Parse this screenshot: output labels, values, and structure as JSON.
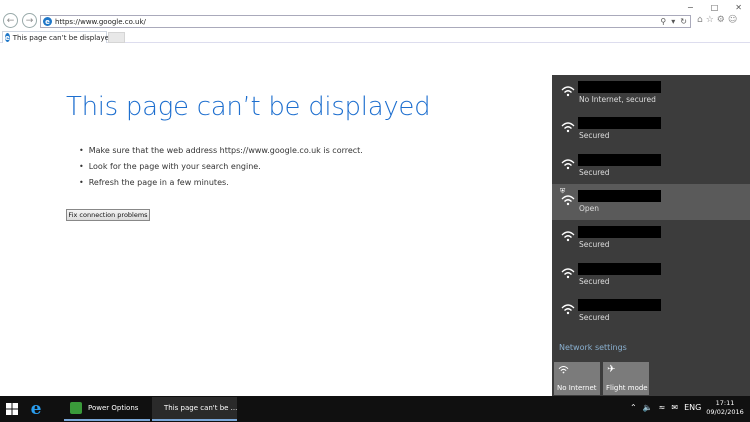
{
  "browser": {
    "url": "https://www.google.co.uk/",
    "tab_title": "This page can’t be displayed",
    "window_controls": [
      "−",
      "□",
      "✕"
    ],
    "addr_tools": [
      "search-icon",
      "dropdown-icon",
      "refresh-icon"
    ],
    "right_tools": [
      "home-icon",
      "star-icon",
      "gear-icon",
      "smiley-icon"
    ]
  },
  "page": {
    "title": "This page can’t be displayed",
    "bullets": [
      "Make sure that the web address https://www.google.co.uk is correct.",
      "Look for the page with your search engine.",
      "Refresh the page in a few minutes."
    ],
    "fix_button": "Fix connection problems"
  },
  "network_flyout": {
    "networks": [
      {
        "status": "No Internet, secured",
        "selected": false,
        "shield": false
      },
      {
        "status": "Secured",
        "selected": false,
        "shield": false
      },
      {
        "status": "Secured",
        "selected": false,
        "shield": false
      },
      {
        "status": "Open",
        "selected": true,
        "shield": true
      },
      {
        "status": "Secured",
        "selected": false,
        "shield": false
      },
      {
        "status": "Secured",
        "selected": false,
        "shield": false
      },
      {
        "status": "Secured",
        "selected": false,
        "shield": false
      }
    ],
    "settings_link": "Network settings",
    "quick_actions": [
      {
        "label": "No Internet",
        "icon": "wifi-icon"
      },
      {
        "label": "Flight mode",
        "icon": "airplane-icon"
      }
    ],
    "colors": {
      "background": "#3c3c3c",
      "selected": "#5a5a5a",
      "tile": "#7b7b7b",
      "link": "#8ab0d0"
    }
  },
  "taskbar": {
    "apps": [
      {
        "label": "Power Options",
        "active": false,
        "icon_color": "#3a9a3a"
      },
      {
        "label": "This page can't be ...",
        "active": true,
        "icon_color": "#1f77c8"
      }
    ],
    "tray_lang": "ENG",
    "time": "17:11",
    "date": "09/02/2016"
  },
  "colors": {
    "accent": "#1e6fcf",
    "taskbar": "#101010"
  }
}
